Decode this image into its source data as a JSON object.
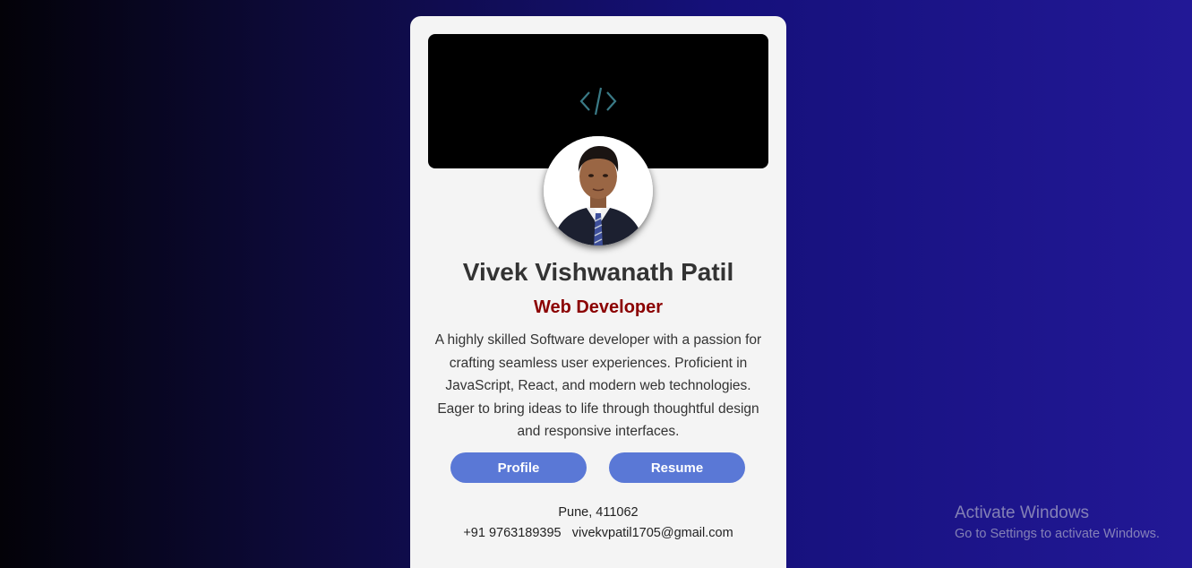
{
  "card": {
    "name": "Vivek Vishwanath Patil",
    "role": "Web Developer",
    "bio": "A highly skilled Software developer with a passion for crafting seamless user experiences. Proficient in JavaScript, React, and modern web technologies. Eager to bring ideas to life through thoughtful design and responsive interfaces.",
    "buttons": {
      "profile_label": "Profile",
      "resume_label": "Resume"
    },
    "location": "Pune, 411062",
    "phone": "+91 9763189395",
    "email": "vivekvpatil1705@gmail.com",
    "banner_icon": "code-icon",
    "avatar_icon": "profile-photo"
  },
  "watermark": {
    "title": "Activate Windows",
    "subtitle": "Go to Settings to activate Windows."
  },
  "colors": {
    "accent_button": "#5a78d6",
    "role_text": "#8b0000",
    "card_bg": "#f4f4f4"
  }
}
